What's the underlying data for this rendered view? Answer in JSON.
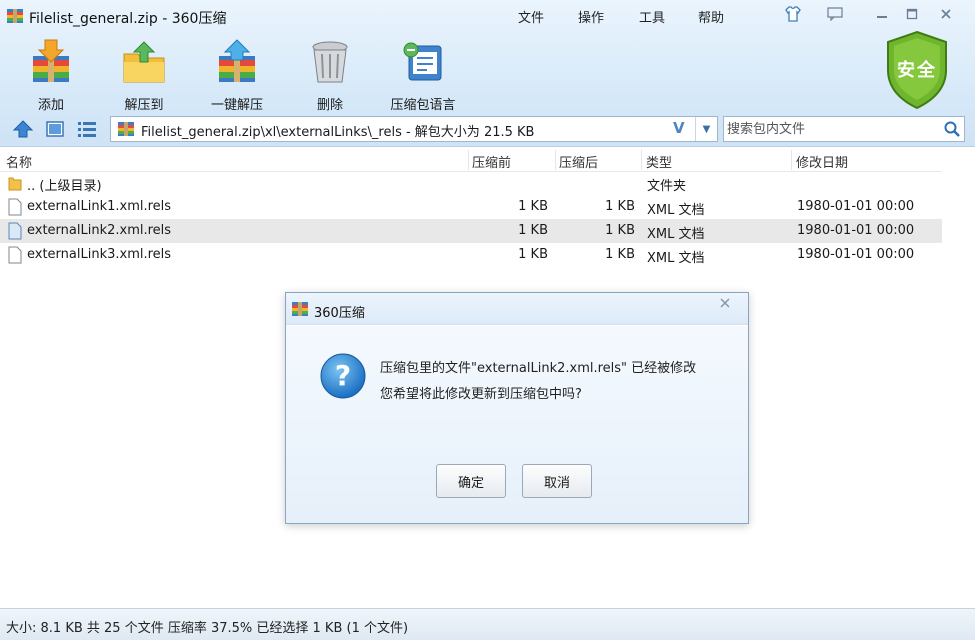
{
  "window": {
    "title": "Filelist_general.zip - 360压缩"
  },
  "menu": {
    "items": [
      "文件",
      "操作",
      "工具",
      "帮助"
    ]
  },
  "toolbar": {
    "add": "添加",
    "extract_to": "解压到",
    "one_click": "一键解压",
    "delete": "删除",
    "language": "压缩包语言"
  },
  "security": {
    "label": "安全"
  },
  "address": {
    "path": "Filelist_general.zip\\xl\\externalLinks\\_rels - 解包大小为 21.5 KB",
    "v_mark": "V"
  },
  "search": {
    "placeholder": "搜索包内文件"
  },
  "columns": {
    "name": "名称",
    "packed": "压缩前",
    "unpacked": "压缩后",
    "type": "类型",
    "modified": "修改日期"
  },
  "files": [
    {
      "name": ".. (上级目录)",
      "packed": "",
      "unpacked": "",
      "type": "文件夹",
      "modified": ""
    },
    {
      "name": "externalLink1.xml.rels",
      "packed": "1 KB",
      "unpacked": "1 KB",
      "type": "XML 文档",
      "modified": "1980-01-01 00:00"
    },
    {
      "name": "externalLink2.xml.rels",
      "packed": "1 KB",
      "unpacked": "1 KB",
      "type": "XML 文档",
      "modified": "1980-01-01 00:00"
    },
    {
      "name": "externalLink3.xml.rels",
      "packed": "1 KB",
      "unpacked": "1 KB",
      "type": "XML 文档",
      "modified": "1980-01-01 00:00"
    }
  ],
  "dialog": {
    "title": "360压缩",
    "message_line1": "压缩包里的文件\"externalLink2.xml.rels\" 已经被修改",
    "message_line2": "您希望将此修改更新到压缩包中吗?",
    "ok": "确定",
    "cancel": "取消"
  },
  "status": {
    "text": "大小: 8.1 KB 共 25 个文件 压缩率 37.5% 已经选择 1 KB (1 个文件)"
  }
}
